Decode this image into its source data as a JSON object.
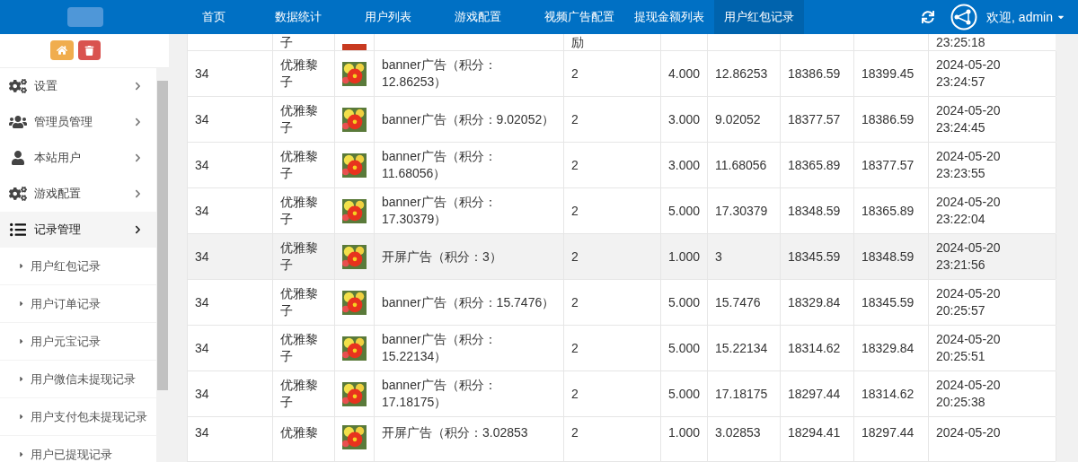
{
  "header": {
    "nav": [
      {
        "label": "首页",
        "selected": false
      },
      {
        "label": "数据统计",
        "selected": false
      },
      {
        "label": "用户列表",
        "selected": false
      },
      {
        "label": "游戏配置",
        "selected": false
      },
      {
        "label": "视频广告配置",
        "selected": false
      },
      {
        "label": "提现金额列表",
        "selected": false
      },
      {
        "label": "用户红包记录",
        "selected": true
      }
    ],
    "user": "欢迎, admin"
  },
  "sidebar": {
    "menu": [
      {
        "label": "设置",
        "expanded": false
      },
      {
        "label": "管理员管理",
        "expanded": false
      },
      {
        "label": "本站用户",
        "expanded": false
      },
      {
        "label": "游戏配置",
        "expanded": false
      },
      {
        "label": "记录管理",
        "expanded": true,
        "children": [
          {
            "label": "用户红包记录"
          },
          {
            "label": "用户订单记录"
          },
          {
            "label": "用户元宝记录"
          },
          {
            "label": "用户微信未提现记录"
          },
          {
            "label": "用户支付包未提现记录"
          },
          {
            "label": "用户已提现记录"
          }
        ]
      }
    ]
  },
  "table": {
    "top_partial_row": {
      "column_2": "子",
      "column_5": "励",
      "column_10": "23:25:18"
    },
    "rows": [
      {
        "highlighted": false,
        "cells": [
          "34",
          "优雅黎子",
          "banner广告（积分：12.86253）",
          "2",
          "4.000",
          "12.86253",
          "18386.59",
          "18399.45",
          "2024-05-20 23:24:57"
        ]
      },
      {
        "highlighted": false,
        "cells": [
          "34",
          "优雅黎子",
          "banner广告（积分：9.02052）",
          "2",
          "3.000",
          "9.02052",
          "18377.57",
          "18386.59",
          "2024-05-20 23:24:45"
        ]
      },
      {
        "highlighted": false,
        "cells": [
          "34",
          "优雅黎子",
          "banner广告（积分：11.68056）",
          "2",
          "3.000",
          "11.68056",
          "18365.89",
          "18377.57",
          "2024-05-20 23:23:55"
        ]
      },
      {
        "highlighted": false,
        "cells": [
          "34",
          "优雅黎子",
          "banner广告（积分：17.30379）",
          "2",
          "5.000",
          "17.30379",
          "18348.59",
          "18365.89",
          "2024-05-20 23:22:04"
        ]
      },
      {
        "highlighted": true,
        "cells": [
          "34",
          "优雅黎子",
          "开屏广告（积分：3）",
          "2",
          "1.000",
          "3",
          "18345.59",
          "18348.59",
          "2024-05-20 23:21:56"
        ]
      },
      {
        "highlighted": false,
        "cells": [
          "34",
          "优雅黎子",
          "banner广告（积分：15.7476）",
          "2",
          "5.000",
          "15.7476",
          "18329.84",
          "18345.59",
          "2024-05-20 20:25:57"
        ]
      },
      {
        "highlighted": false,
        "cells": [
          "34",
          "优雅黎子",
          "banner广告（积分：15.22134）",
          "2",
          "5.000",
          "15.22134",
          "18314.62",
          "18329.84",
          "2024-05-20 20:25:51"
        ]
      },
      {
        "highlighted": false,
        "cells": [
          "34",
          "优雅黎子",
          "banner广告（积分：17.18175）",
          "2",
          "5.000",
          "17.18175",
          "18297.44",
          "18314.62",
          "2024-05-20 20:25:38"
        ]
      },
      {
        "highlighted": false,
        "partial": true,
        "cells": [
          "34",
          "优雅黎",
          "开屏广告（积分：3.02853",
          "2",
          "1.000",
          "3.02853",
          "18294.41",
          "18297.44",
          "2024-05-20"
        ]
      }
    ]
  }
}
